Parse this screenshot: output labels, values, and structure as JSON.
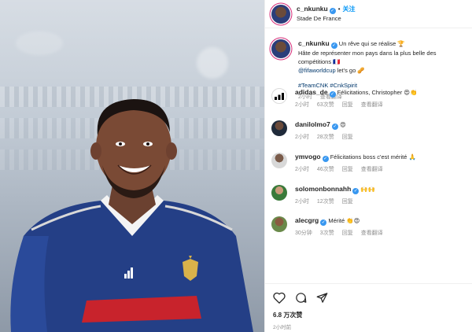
{
  "post": {
    "username": "c_nkunku",
    "verified_mark": "✓",
    "separator": "•",
    "follow_label": "关注",
    "location": "Stade De France"
  },
  "caption": {
    "username": "c_nkunku",
    "line1": "Un rêve qui se réalise 🏆",
    "line2": "Hâte de représenter mon pays dans la plus belle des compétitions 🇫🇷",
    "mention": "@fifaworldcup",
    "line3_rest": " let's go 🥜",
    "hashtags": "#TeamCNK #CnkSpirit",
    "time": "2小时",
    "translate": "查看翻译"
  },
  "comments": [
    {
      "username": "adidas_de",
      "verified": true,
      "text": "Félicitations, Christopher 😍👏",
      "time": "2小时",
      "likes": "63次赞",
      "reply": "回复",
      "translate": "查看翻译",
      "avatar": "adidas-logo"
    },
    {
      "username": "danilolmo7",
      "verified": true,
      "text": "😍",
      "time": "2小时",
      "likes": "28次赞",
      "reply": "回复",
      "translate": "",
      "avatar": "user-photo"
    },
    {
      "username": "ymvogo",
      "verified": true,
      "text": "Félicitations boss c'est mérité 🙏",
      "time": "2小时",
      "likes": "46次赞",
      "reply": "回复",
      "translate": "查看翻译",
      "avatar": "user-photo"
    },
    {
      "username": "solomonbonnahh",
      "verified": true,
      "text": "🙌🙌",
      "time": "2小时",
      "likes": "12次赞",
      "reply": "回复",
      "translate": "",
      "avatar": "user-photo"
    },
    {
      "username": "alecgrg",
      "verified": true,
      "text": "Mérité 👏😍",
      "time": "30分钟",
      "likes": "3次赞",
      "reply": "回复",
      "translate": "查看翻译",
      "avatar": "user-photo"
    }
  ],
  "footer": {
    "likes": "6.8 万次赞",
    "time": "2小时前"
  },
  "icons": [
    "heart-icon",
    "comment-icon",
    "share-icon"
  ],
  "colors": {
    "accent": "#0095f6",
    "verified": "#3897f0",
    "muted": "#8e8e8e",
    "jersey": "#1e3a8a"
  }
}
